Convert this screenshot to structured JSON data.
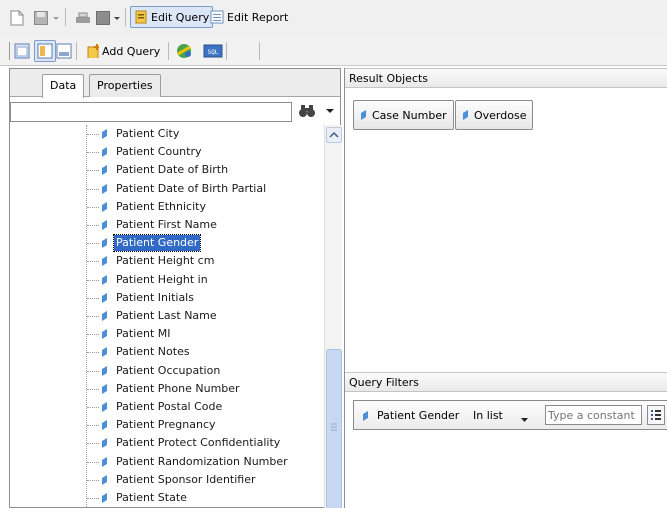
{
  "toolbar": {
    "edit_query_label": "Edit Query",
    "edit_report_label": "Edit Report",
    "add_query_label": "Add Query",
    "sql_label": "SQL"
  },
  "left_panel": {
    "tabs": [
      "Data",
      "Properties"
    ],
    "search_value": "",
    "tree_items": [
      {
        "label": "Patient City"
      },
      {
        "label": "Patient Country"
      },
      {
        "label": "Patient Date of Birth"
      },
      {
        "label": "Patient Date of Birth Partial"
      },
      {
        "label": "Patient Ethnicity"
      },
      {
        "label": "Patient First Name"
      },
      {
        "label": "Patient Gender",
        "selected": true
      },
      {
        "label": "Patient Height cm"
      },
      {
        "label": "Patient Height in"
      },
      {
        "label": "Patient Initials"
      },
      {
        "label": "Patient Last Name"
      },
      {
        "label": "Patient MI"
      },
      {
        "label": "Patient Notes"
      },
      {
        "label": "Patient Occupation"
      },
      {
        "label": "Patient Phone Number"
      },
      {
        "label": "Patient Postal Code"
      },
      {
        "label": "Patient Pregnancy"
      },
      {
        "label": "Patient Protect Confidentiality"
      },
      {
        "label": "Patient Randomization Number"
      },
      {
        "label": "Patient Sponsor Identifier"
      },
      {
        "label": "Patient State"
      }
    ]
  },
  "result_objects": {
    "title": "Result Objects",
    "items": [
      "Case Number",
      "Overdose"
    ]
  },
  "query_filters": {
    "title": "Query Filters",
    "filter": {
      "object": "Patient Gender",
      "operator": "In list",
      "placeholder": "Type a constant"
    }
  },
  "colors": {
    "selection": "#316ac5",
    "dimension_icon": "#4d8fd6"
  }
}
